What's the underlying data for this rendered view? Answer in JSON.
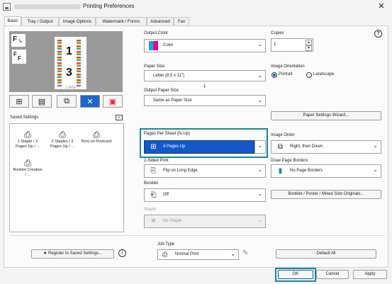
{
  "title": "Printing Preferences",
  "tabs": [
    "Basic",
    "Tray / Output",
    "Image Options",
    "Watermark / Forms",
    "Advanced",
    "Fax"
  ],
  "preview": {
    "page1": "1",
    "page3": "3",
    "paper_label": "Letter"
  },
  "icons": {
    "view1": "⊞",
    "view2": "▤",
    "view3": "⧉",
    "view4": "✕",
    "view5": "▣"
  },
  "saved_settings": {
    "label": "Saved Settings",
    "items": [
      {
        "icon": "⎙",
        "label": "1 Staple / 2 Pages Up / ..."
      },
      {
        "icon": "⎙",
        "label": "2 Staples / 2 Pages Up / ..."
      },
      {
        "icon": "⎙",
        "label": "Print on Postcard"
      },
      {
        "icon": "⎙",
        "label": "Booklet Creation / ..."
      }
    ]
  },
  "output_color": {
    "label": "Output Color",
    "value": "Color"
  },
  "copies": {
    "label": "Copies",
    "value": "1"
  },
  "paper_size": {
    "label": "Paper Size",
    "value": "Letter (8.5 x 11\")"
  },
  "output_paper_size": {
    "label": "Output Paper Size",
    "value": "Same as Paper Size"
  },
  "image_orientation": {
    "label": "Image Orientation",
    "portrait": "Portrait",
    "landscape": "Landscape"
  },
  "paper_settings_wizard": "Paper Settings Wizard...",
  "pages_per_sheet": {
    "label": "Pages Per Sheet (N-Up)",
    "value": "4 Pages Up"
  },
  "image_order": {
    "label": "Image Order",
    "value": "Right, then Down"
  },
  "two_sided": {
    "label": "2-Sided Print",
    "value": "Flip on Long Edge"
  },
  "page_borders": {
    "label": "Draw Page Borders",
    "value": "No Page Borders"
  },
  "booklet": {
    "label": "Booklet",
    "value": "Off"
  },
  "booklet_poster_btn": "Booklet / Poster / Mixed Size Originals...",
  "staple": {
    "label": "Staple",
    "value": "No Staple"
  },
  "register_btn": "Register to Saved Settings...",
  "job_type": {
    "label": "Job Type",
    "value": "Normal Print"
  },
  "default_all": "Default All",
  "ok": "OK",
  "cancel": "Cancel",
  "apply": "Apply",
  "colors": {
    "selection": "#1557c6",
    "highlight": "#1a8a8f"
  }
}
